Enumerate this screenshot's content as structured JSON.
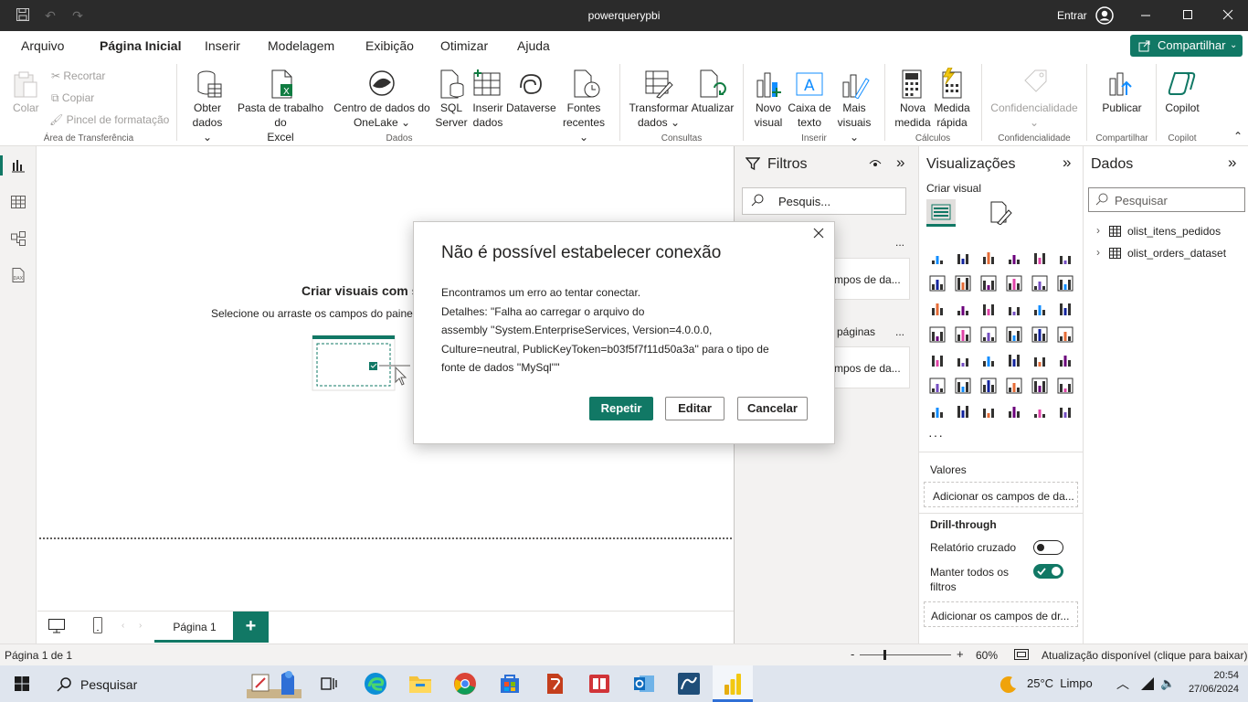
{
  "window": {
    "title": "powerquerypbi",
    "sign_in": "Entrar"
  },
  "menu": {
    "tabs": [
      "Arquivo",
      "Página Inicial",
      "Inserir",
      "Modelagem",
      "Exibição",
      "Otimizar",
      "Ajuda"
    ],
    "share": "Compartilhar"
  },
  "ribbon": {
    "clipboard": {
      "paste": "Colar",
      "cut": "Recortar",
      "copy": "Copiar",
      "format_painter": "Pincel de formatação",
      "group": "Área de Transferência"
    },
    "data": {
      "get_data_1": "Obter",
      "get_data_2": "dados",
      "excel_1": "Pasta de trabalho do",
      "excel_2": "Excel",
      "onelake_1": "Centro de dados do",
      "onelake_2": "OneLake",
      "sql_1": "SQL",
      "sql_2": "Server",
      "enter_1": "Inserir",
      "enter_2": "dados",
      "dataverse": "Dataverse",
      "recent_1": "Fontes",
      "recent_2": "recentes",
      "group": "Dados"
    },
    "queries": {
      "transform_1": "Transformar",
      "transform_2": "dados",
      "refresh": "Atualizar",
      "group": "Consultas"
    },
    "insert": {
      "new_visual_1": "Novo",
      "new_visual_2": "visual",
      "textbox_1": "Caixa de",
      "textbox_2": "texto",
      "more_visuals_1": "Mais",
      "more_visuals_2": "visuais",
      "group": "Inserir"
    },
    "calc": {
      "new_measure_1": "Nova",
      "new_measure_2": "medida",
      "quick_measure_1": "Medida",
      "quick_measure_2": "rápida",
      "group": "Cálculos"
    },
    "sensitivity": {
      "label": "Confidencialidade",
      "group": "Confidencialidade"
    },
    "share": {
      "publish": "Publicar",
      "group": "Compartilhar"
    },
    "copilot": {
      "label": "Copilot",
      "group": "Copilot"
    }
  },
  "canvas": {
    "placeholder_title": "Criar visuais com se",
    "placeholder_sub": "Selecione ou arraste os campos do painel"
  },
  "pages": {
    "tab": "Página 1"
  },
  "filters": {
    "title": "Filtros",
    "search_placeholder": "Pesquis...",
    "visual_section_more": "...",
    "add_fields_1": "mpos de da...",
    "all_pages_label": "páginas",
    "all_pages_more": "...",
    "add_fields_2": "mpos de da..."
  },
  "viz": {
    "title": "Visualizações",
    "build_visual": "Criar visual",
    "more": "···",
    "values": "Valores",
    "values_placeholder": "Adicionar os campos de da...",
    "drillthrough": "Drill-through",
    "cross_report": "Relatório cruzado",
    "cross_report_on": false,
    "keep_filters": "Manter todos os filtros",
    "keep_filters_on": true,
    "drill_placeholder": "Adicionar os campos de dr..."
  },
  "data_pane": {
    "title": "Dados",
    "search_placeholder": "Pesquisar",
    "tables": [
      "olist_itens_pedidos",
      "olist_orders_dataset"
    ]
  },
  "status": {
    "page": "Página 1 de 1",
    "zoom_minus": "-",
    "zoom_plus": "+",
    "zoom": "60%",
    "update": "Atualização disponível (clique para baixar)"
  },
  "taskbar": {
    "search": "Pesquisar",
    "weather": "25°C  Limpo",
    "time": "20:54",
    "date": "27/06/2024"
  },
  "dialog": {
    "title": "Não é possível estabelecer conexão",
    "line1": "Encontramos um erro ao tentar conectar.",
    "line2": "Detalhes: \"Falha ao carregar o arquivo do",
    "line3": "assembly ''System.EnterpriseServices, Version=4.0.0.0,",
    "line4": "Culture=neutral, PublicKeyToken=b03f5f7f11d50a3a'' para o tipo de",
    "line5": "fonte de dados ''MySql''\"",
    "retry": "Repetir",
    "edit": "Editar",
    "cancel": "Cancelar"
  },
  "colors": {
    "accent": "#117865",
    "titlebar": "#2b2b2b",
    "pane_bg": "#f3f2f1"
  }
}
